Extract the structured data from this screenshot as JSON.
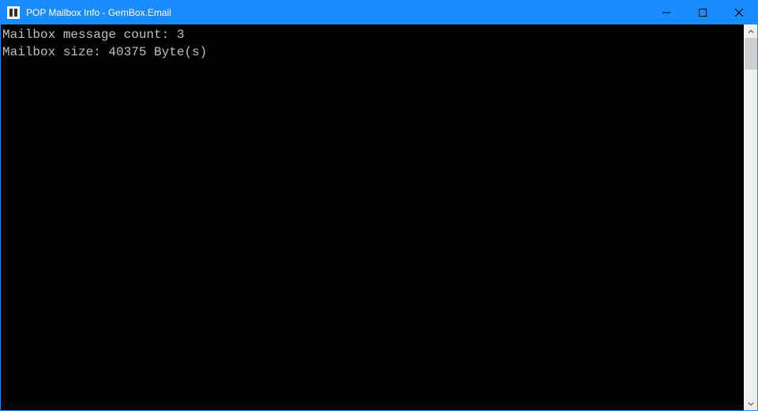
{
  "window": {
    "title": "POP Mailbox Info - GemBox.Email"
  },
  "console": {
    "line1_label": "Mailbox message count: ",
    "line1_value": "3",
    "line2_label": "Mailbox size: ",
    "line2_value": "40375",
    "line2_unit": " Byte(s)"
  }
}
